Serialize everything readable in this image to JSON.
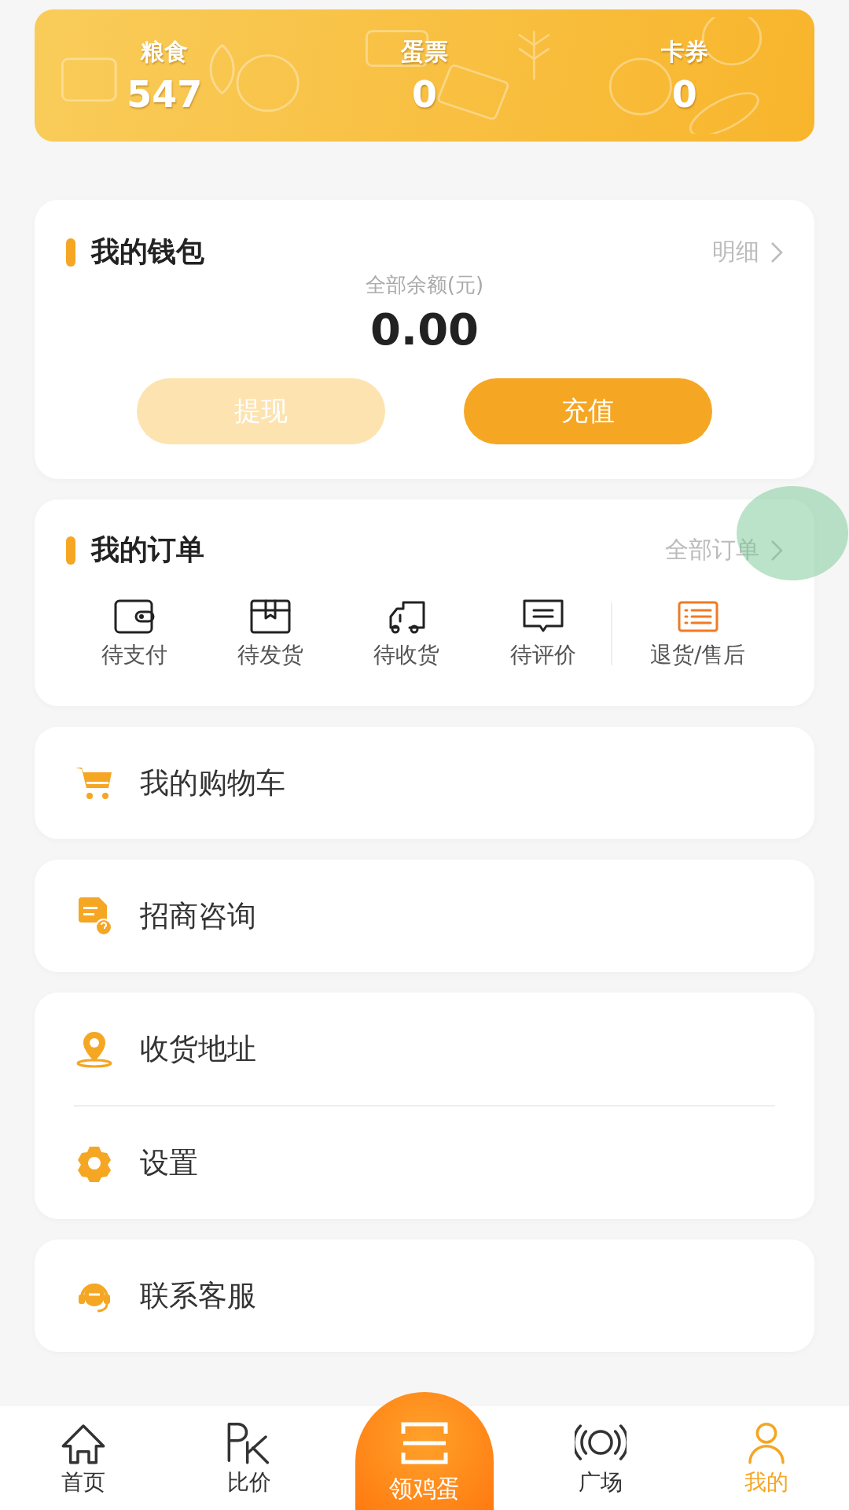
{
  "stats": [
    {
      "label": "粮食",
      "value": "547"
    },
    {
      "label": "蛋票",
      "value": "0"
    },
    {
      "label": "卡券",
      "value": "0"
    }
  ],
  "wallet": {
    "title": "我的钱包",
    "link": "明细",
    "balance_label": "全部余额(元)",
    "balance": "0.00",
    "buttons": [
      {
        "label": "提现",
        "disabled": true
      },
      {
        "label": "充值",
        "disabled": false
      }
    ]
  },
  "orders": {
    "title": "我的订单",
    "link": "全部订单",
    "items": [
      {
        "label": "待支付",
        "kind": "wallet",
        "highlighted": false
      },
      {
        "label": "待发货",
        "kind": "box",
        "highlighted": false
      },
      {
        "label": "待收货",
        "kind": "truck",
        "highlighted": false
      },
      {
        "label": "待评价",
        "kind": "comment",
        "highlighted": false
      },
      {
        "label": "退货/售后",
        "kind": "list",
        "highlighted": true
      }
    ]
  },
  "menu_groups": [
    [
      {
        "label": "我的购物车",
        "kind": "cart"
      }
    ],
    [
      {
        "label": "招商咨询",
        "kind": "doc"
      }
    ],
    [
      {
        "label": "收货地址",
        "kind": "pin"
      },
      {
        "label": "设置",
        "kind": "gear"
      }
    ],
    [
      {
        "label": "联系客服",
        "kind": "headset"
      }
    ]
  ],
  "tab_bar": [
    {
      "label": "首页",
      "kind": "home",
      "selected": false
    },
    {
      "label": "比价",
      "kind": "pk",
      "selected": false
    },
    {
      "label": "领鸡蛋",
      "kind": "center"
    },
    {
      "label": "广场",
      "kind": "signal",
      "selected": false
    },
    {
      "label": "我的",
      "kind": "person",
      "selected": true
    }
  ]
}
